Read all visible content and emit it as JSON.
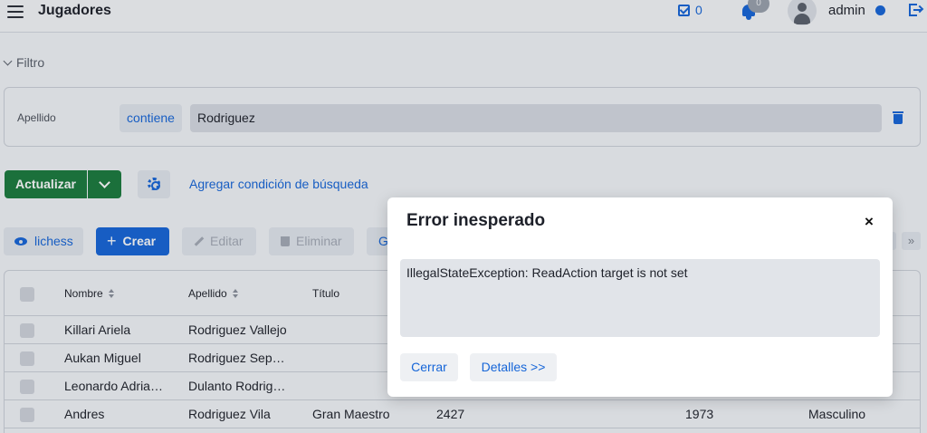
{
  "header": {
    "title": "Jugadores",
    "tasks_count": "0",
    "notifications_count": "0",
    "username": "admin"
  },
  "filter": {
    "toggle_label": "Filtro",
    "field_label": "Apellido",
    "operator": "contiene",
    "value": "Rodriguez"
  },
  "actions": {
    "refresh_label": "Actualizar",
    "add_condition_label": "Agregar condición de búsqueda"
  },
  "toolbar": {
    "lichess_label": "lichess",
    "create_label": "Crear",
    "edit_label": "Editar",
    "delete_label": "Eliminar",
    "partial_label": "G",
    "next_page": "»"
  },
  "table": {
    "headers": [
      "Nombre",
      "Apellido",
      "Título"
    ],
    "rows": [
      [
        "Killari Ariela",
        "Rodriguez Vallejo",
        "",
        "",
        "",
        ""
      ],
      [
        "Aukan Miguel",
        "Rodriguez Sep…",
        "",
        "",
        "",
        ""
      ],
      [
        "Leonardo Adria…",
        "Dulanto Rodrig…",
        "",
        "",
        "",
        ""
      ],
      [
        "Andres",
        "Rodriguez Vila",
        "Gran Maestro",
        "2427",
        "1973",
        "Masculino"
      ]
    ]
  },
  "modal": {
    "title": "Error inesperado",
    "close_glyph": "×",
    "message": "IllegalStateException: ReadAction target is not set",
    "close_button": "Cerrar",
    "details_button": "Detalles >>"
  },
  "colors": {
    "primary": "#1565d8",
    "success": "#1a7a3c",
    "background": "#f3f5f8"
  },
  "icons": [
    "menu-icon",
    "tasks-icon",
    "bell-icon",
    "user-icon",
    "logout-icon",
    "chevron-down-icon",
    "trash-icon",
    "gear-icon",
    "eye-icon",
    "plus-icon",
    "pencil-icon",
    "sort-icon",
    "close-icon"
  ]
}
